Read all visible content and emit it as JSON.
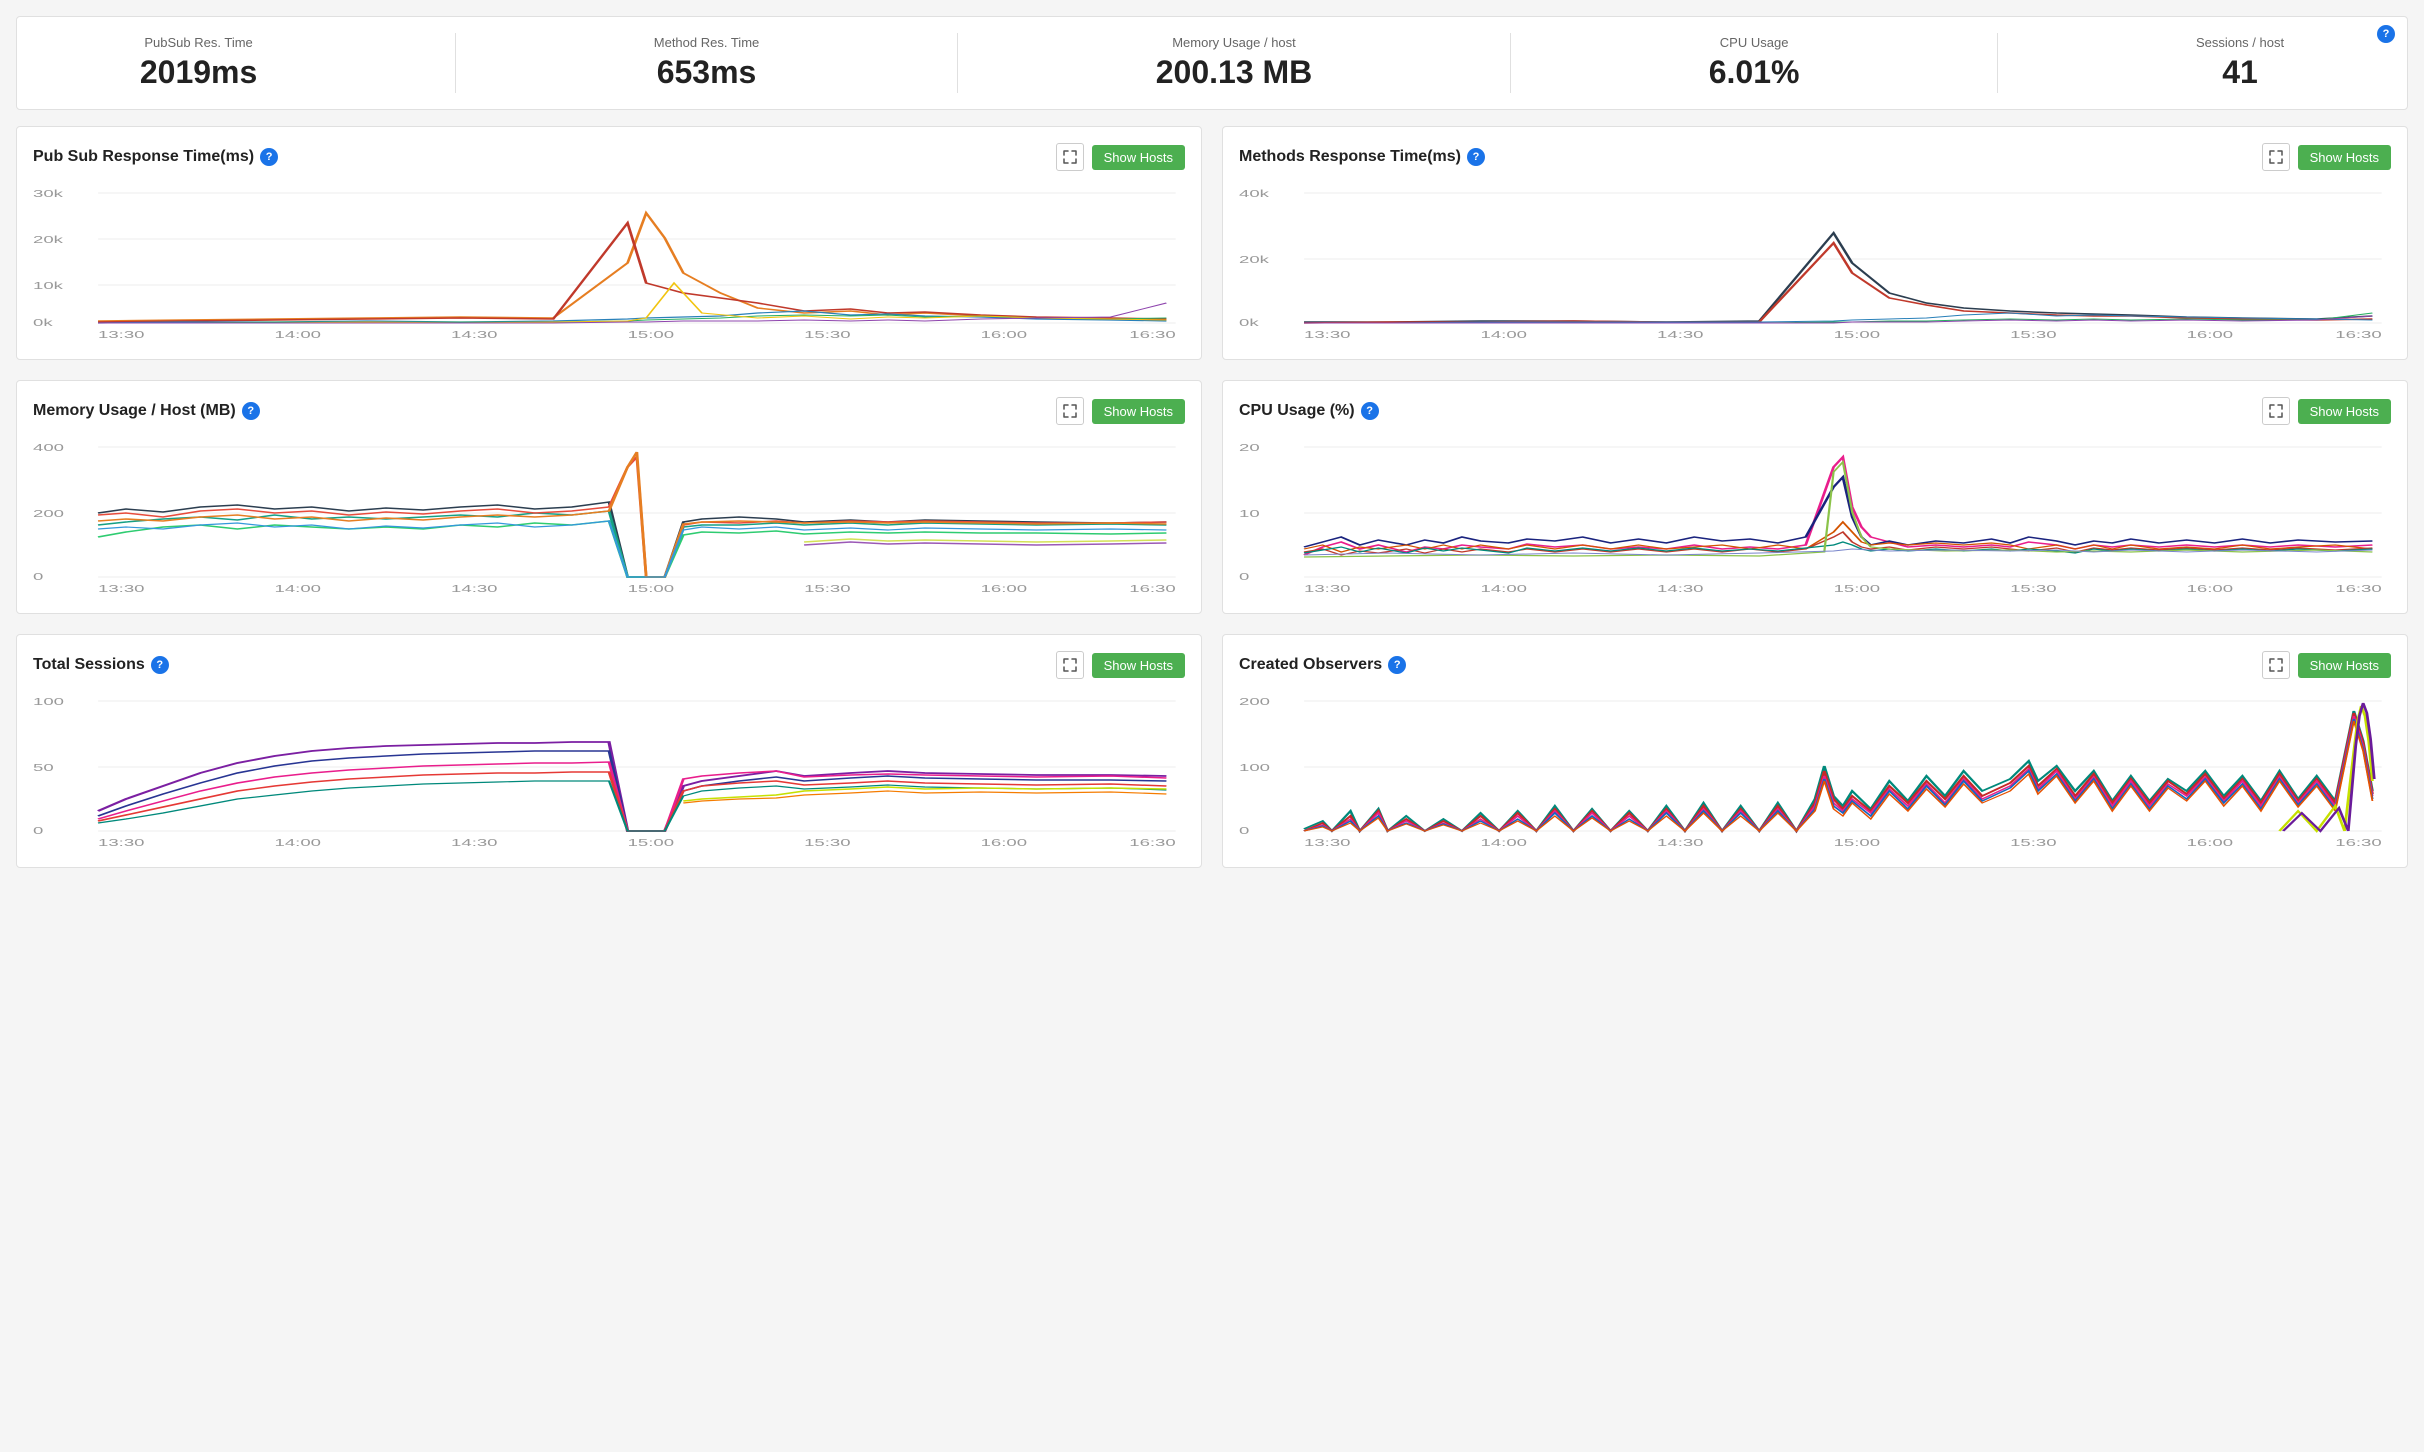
{
  "topStats": {
    "items": [
      {
        "label": "PubSub Res. Time",
        "value": "2019ms"
      },
      {
        "label": "Method Res. Time",
        "value": "653ms"
      },
      {
        "label": "Memory Usage / host",
        "value": "200.13 MB"
      },
      {
        "label": "CPU Usage",
        "value": "6.01%"
      },
      {
        "label": "Sessions / host",
        "value": "41"
      }
    ]
  },
  "charts": [
    {
      "id": "pubsub",
      "title": "Pub Sub Response Time(ms)",
      "showHostsLabel": "Show Hosts",
      "yAxisLabels": [
        "30k",
        "20k",
        "10k",
        "0k"
      ],
      "xAxisLabels": [
        "13:30",
        "14:00",
        "14:30",
        "15:00",
        "15:30",
        "16:00",
        "16:30"
      ]
    },
    {
      "id": "methods",
      "title": "Methods Response Time(ms)",
      "showHostsLabel": "Show Hosts",
      "yAxisLabels": [
        "40k",
        "20k",
        "0k"
      ],
      "xAxisLabels": [
        "13:30",
        "14:00",
        "14:30",
        "15:00",
        "15:30",
        "16:00",
        "16:30"
      ]
    },
    {
      "id": "memory",
      "title": "Memory Usage / Host (MB)",
      "showHostsLabel": "Show Hosts",
      "yAxisLabels": [
        "400",
        "200",
        "0"
      ],
      "xAxisLabels": [
        "13:30",
        "14:00",
        "14:30",
        "15:00",
        "15:30",
        "16:00",
        "16:30"
      ]
    },
    {
      "id": "cpu",
      "title": "CPU Usage (%)",
      "showHostsLabel": "Show Hosts",
      "yAxisLabels": [
        "20",
        "10",
        "0"
      ],
      "xAxisLabels": [
        "13:30",
        "14:00",
        "14:30",
        "15:00",
        "15:30",
        "16:00",
        "16:30"
      ]
    },
    {
      "id": "sessions",
      "title": "Total Sessions",
      "showHostsLabel": "Show Hosts",
      "yAxisLabels": [
        "100",
        "50",
        "0"
      ],
      "xAxisLabels": [
        "13:30",
        "14:00",
        "14:30",
        "15:00",
        "15:30",
        "16:00",
        "16:30"
      ]
    },
    {
      "id": "observers",
      "title": "Created Observers",
      "showHostsLabel": "Show Hosts",
      "yAxisLabels": [
        "200",
        "100",
        "0"
      ],
      "xAxisLabels": [
        "13:30",
        "14:00",
        "14:30",
        "15:00",
        "15:30",
        "16:00",
        "16:30"
      ]
    }
  ],
  "icons": {
    "help": "?",
    "expand": "⤢"
  }
}
